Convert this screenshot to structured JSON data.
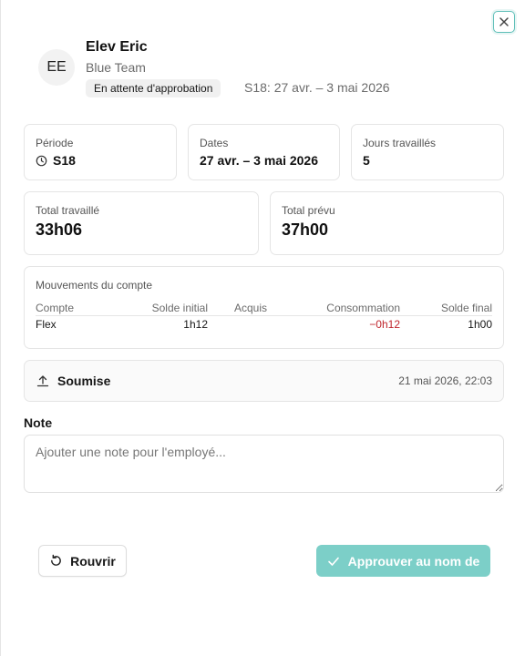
{
  "employee": {
    "initials": "EE",
    "name": "Elev Eric",
    "team": "Blue Team",
    "status_badge": "En attente d'approbation",
    "week_label": "S18: 27 avr. – 3 mai 2026"
  },
  "summary": {
    "periode": {
      "label": "Période",
      "value": "S18"
    },
    "dates": {
      "label": "Dates",
      "value": "27 avr. – 3 mai 2026"
    },
    "jours": {
      "label": "Jours travaillés",
      "value": "5"
    },
    "total_travaille": {
      "label": "Total travaillé",
      "value": "33h06"
    },
    "total_prevu": {
      "label": "Total prévu",
      "value": "37h00"
    }
  },
  "movements": {
    "title": "Mouvements du compte",
    "headers": [
      "Compte",
      "Solde initial",
      "Acquis",
      "Consommation",
      "Solde final"
    ],
    "rows": [
      {
        "compte": "Flex",
        "initial": "1h12",
        "acquis": "",
        "consommation": "−0h12",
        "final": "1h00"
      }
    ]
  },
  "submission": {
    "label": "Soumise",
    "date": "21 mai 2026, 22:03"
  },
  "note": {
    "label": "Note",
    "placeholder": "Ajouter une note pour l'employé...",
    "value": ""
  },
  "actions": {
    "reopen_label": "Rouvrir",
    "approve_label": "Approuver au nom de"
  },
  "colors": {
    "accent": "#7ccfc8",
    "negative": "#c0262d",
    "close_border": "#5fbfb8"
  }
}
